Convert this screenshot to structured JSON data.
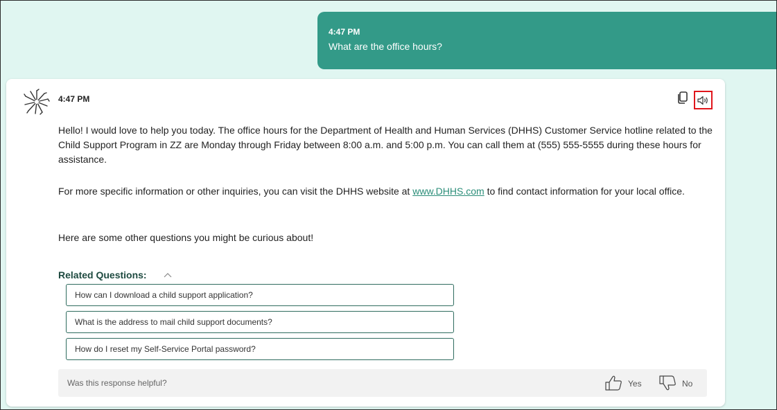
{
  "user_message": {
    "time": "4:47 PM",
    "text": "What are the office hours?"
  },
  "bot_message": {
    "time": "4:47 PM",
    "paragraph1": "Hello! I would love to help you today. The office hours for the Department of Health and Human Services (DHHS) Customer Service hotline related to the Child Support Program in ZZ are Monday through Friday between 8:00 a.m. and 5:00 p.m. You can call them at (555) 555-5555 during these hours for assistance.",
    "paragraph2_before": "For more specific information or other inquiries, you can visit the DHHS website at ",
    "paragraph2_link": "www.DHHS.com",
    "paragraph2_after": " to find contact information for your local office.",
    "paragraph3": "Here are some other questions you might be curious about!",
    "icons": {
      "copy": "copy-icon",
      "read_aloud": "speaker-icon",
      "highlight_color": "#e0151b"
    }
  },
  "related": {
    "heading": "Related Questions:",
    "questions": [
      "How can I download a child support application?",
      "What is the address to mail child support documents?",
      "How do I reset my Self-Service Portal password?"
    ]
  },
  "feedback": {
    "prompt": "Was this response helpful?",
    "yes_label": "Yes",
    "no_label": "No"
  },
  "colors": {
    "background": "#e0f6f1",
    "user_bubble": "#339a88",
    "link": "#2a8d78"
  }
}
